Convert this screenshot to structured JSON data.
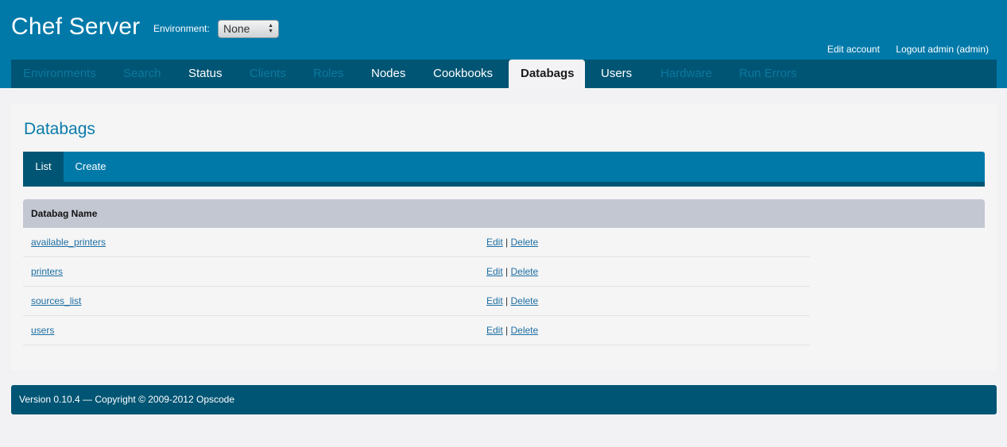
{
  "header": {
    "app_title": "Chef Server",
    "environment_label": "Environment:",
    "environment_value": "None",
    "edit_account": "Edit account",
    "logout": "Logout admin (admin)"
  },
  "nav": {
    "items": [
      {
        "label": "Environments",
        "state": "dim"
      },
      {
        "label": "Search",
        "state": "dim"
      },
      {
        "label": "Status",
        "state": "normal"
      },
      {
        "label": "Clients",
        "state": "dim"
      },
      {
        "label": "Roles",
        "state": "dim"
      },
      {
        "label": "Nodes",
        "state": "normal"
      },
      {
        "label": "Cookbooks",
        "state": "normal"
      },
      {
        "label": "Databags",
        "state": "active"
      },
      {
        "label": "Users",
        "state": "normal"
      },
      {
        "label": "Hardware",
        "state": "dim"
      },
      {
        "label": "Run Errors",
        "state": "dim"
      }
    ]
  },
  "page": {
    "title": "Databags",
    "subnav": {
      "list": "List",
      "create": "Create"
    },
    "table": {
      "column_header": "Databag Name",
      "edit_label": "Edit",
      "separator": "|",
      "delete_label": "Delete",
      "rows": [
        {
          "name": "available_printers"
        },
        {
          "name": "printers"
        },
        {
          "name": "sources_list"
        },
        {
          "name": "users"
        }
      ]
    }
  },
  "footer": {
    "text": "Version 0.10.4 — Copyright © 2009-2012 Opscode"
  },
  "colors": {
    "header_bg": "#0079a9",
    "nav_bg": "#005574",
    "table_header_bg": "#c3c7d1",
    "link": "#1d6ea3"
  },
  "icons": {
    "select_arrows": "chevron-up-down-icon"
  }
}
